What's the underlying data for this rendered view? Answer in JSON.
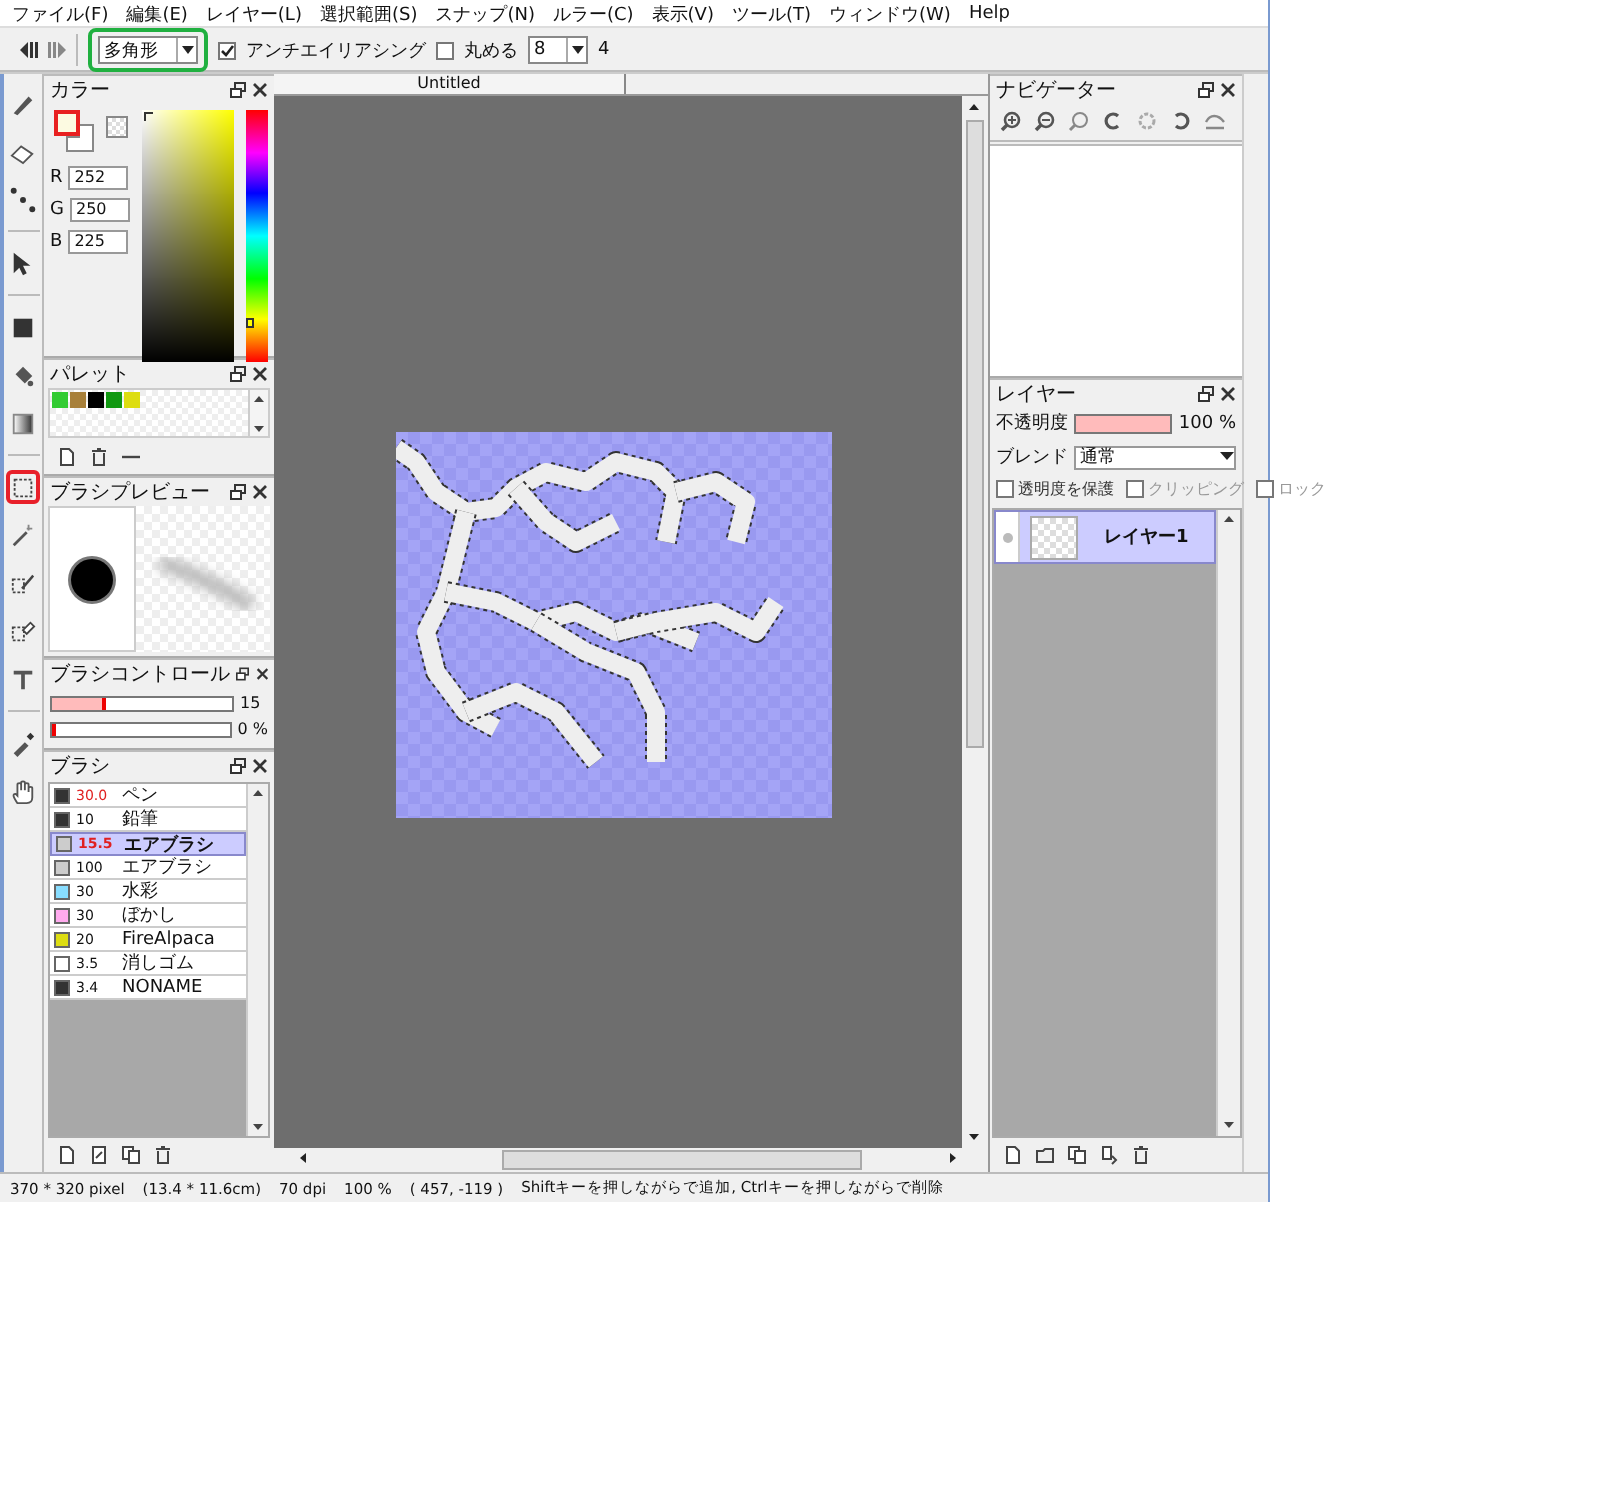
{
  "menu": [
    "ファイル(F)",
    "編集(E)",
    "レイヤー(L)",
    "選択範囲(S)",
    "スナップ(N)",
    "ルラー(C)",
    "表示(V)",
    "ツール(T)",
    "ウィンドウ(W)",
    "Help"
  ],
  "toolbar": {
    "shape": "多角形",
    "antialias": {
      "label": "アンチエイリアシング",
      "checked": true
    },
    "round": {
      "label": "丸める",
      "checked": false
    },
    "round_value": "8",
    "round_unit": "4"
  },
  "highlights": [
    {
      "kind": "tool-frame",
      "color": "#e8202a"
    },
    {
      "kind": "shape-frame",
      "color": "#20b040"
    }
  ],
  "color_panel": {
    "title": "カラー",
    "foreground": {
      "color": "#fcfae1"
    },
    "channels": [
      {
        "label": "R",
        "value": "252"
      },
      {
        "label": "G",
        "value": "250"
      },
      {
        "label": "B",
        "value": "225"
      }
    ]
  },
  "palette": {
    "title": "パレット",
    "swatches": [
      {
        "color": "#33cc33"
      },
      {
        "color": "#a8803a"
      },
      {
        "color": "#000000"
      },
      {
        "color": "#119911"
      },
      {
        "color": "#dddd11"
      }
    ]
  },
  "brush_preview": {
    "title": "ブラシプレビュー"
  },
  "brush_control": {
    "title": "ブラシコントロール",
    "sliders": [
      {
        "level": 0.3,
        "reading": "15"
      },
      {
        "level": 0.01,
        "reading": "0 %"
      }
    ]
  },
  "brushes": {
    "title": "ブラシ",
    "items": [
      {
        "size": "30.0",
        "name": "ペン",
        "color": "#333333",
        "accent": true,
        "selected": false
      },
      {
        "size": "10",
        "name": "鉛筆",
        "color": "#333333",
        "accent": false,
        "selected": false
      },
      {
        "size": "15.5",
        "name": "エアブラシ",
        "color": "#cccccc",
        "accent": true,
        "selected": true
      },
      {
        "size": "100",
        "name": "エアブラシ",
        "color": "#cccccc",
        "accent": false,
        "selected": false
      },
      {
        "size": "30",
        "name": "水彩",
        "color": "#88ddff",
        "accent": false,
        "selected": false
      },
      {
        "size": "30",
        "name": "ぼかし",
        "color": "#ffaaee",
        "accent": false,
        "selected": false
      },
      {
        "size": "20",
        "name": "FireAlpaca",
        "color": "#dddd11",
        "accent": false,
        "selected": false
      },
      {
        "size": "3.5",
        "name": "消しゴム",
        "color": "#ffffff",
        "accent": false,
        "selected": false
      },
      {
        "size": "3.4",
        "name": "NONAME",
        "color": "#333333",
        "accent": false,
        "selected": false
      }
    ]
  },
  "canvas": {
    "tab": "Untitled"
  },
  "navigator": {
    "title": "ナビゲーター"
  },
  "layers": {
    "title": "レイヤー",
    "opacity_label": "不透明度",
    "opacity_bar": {
      "level": 1
    },
    "opacity": "100 %",
    "blend_label": "ブレンド",
    "blend": "通常",
    "options": [
      {
        "label": "透明度を保護",
        "checked": false
      },
      {
        "label": "クリッピング",
        "checked": false
      },
      {
        "label": "ロック",
        "checked": false
      }
    ],
    "items": [
      {
        "name": "レイヤー1",
        "selected": true
      }
    ]
  },
  "status": [
    "370 * 320 pixel",
    "(13.4 * 11.6cm)",
    "70 dpi",
    "100 %",
    "( 457, -119 )",
    "Shiftキーを押しながらで追加, Ctrlキーを押しながらで削除"
  ]
}
